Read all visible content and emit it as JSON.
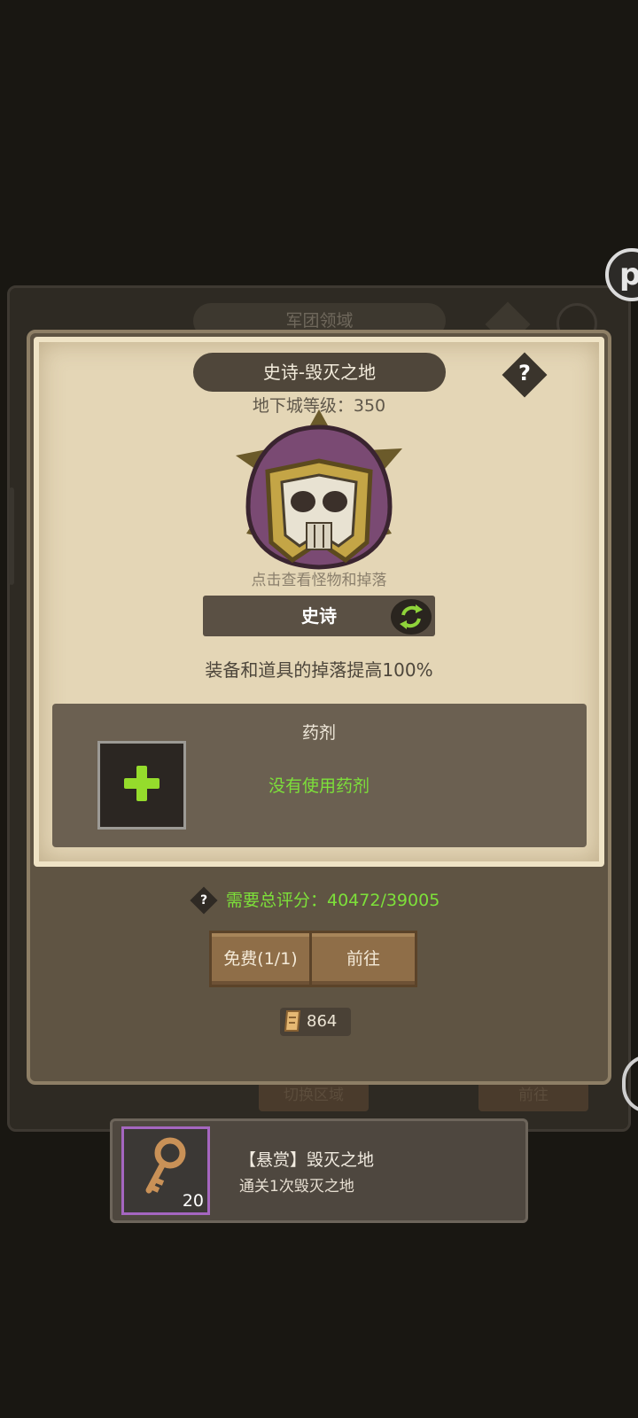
{
  "background": {
    "window_title": "军团领域",
    "help_button": "?",
    "bottom_buttons": [
      "切换区域",
      "前往"
    ]
  },
  "modal": {
    "title": "史诗-毁灭之地",
    "help_button": "?",
    "dungeon_level": "地下城等级：350",
    "boss_hint": "点击查看怪物和掉落",
    "difficulty": "史诗",
    "drop_bonus": "装备和道具的掉落提高100%",
    "potion": {
      "title": "药剂",
      "empty_text": "没有使用药剂"
    },
    "requirement": {
      "help": "?",
      "text": "需要总评分：40472/39005"
    },
    "buttons": {
      "free": "免费(1/1)",
      "go": "前往"
    },
    "cost": "864"
  },
  "quest": {
    "title": "【悬赏】毁灭之地",
    "description": "通关1次毁灭之地",
    "reward_count": "20"
  },
  "icons": {
    "float_button": "p-icon",
    "cycle": "cycle-arrows-icon",
    "plus": "plus-icon",
    "scroll": "scroll-icon",
    "key": "key-icon"
  },
  "colors": {
    "accent_green": "#7de03a",
    "panel": "#5f5443",
    "paper": "#e4d6b6",
    "rare_border": "#a566c0"
  }
}
